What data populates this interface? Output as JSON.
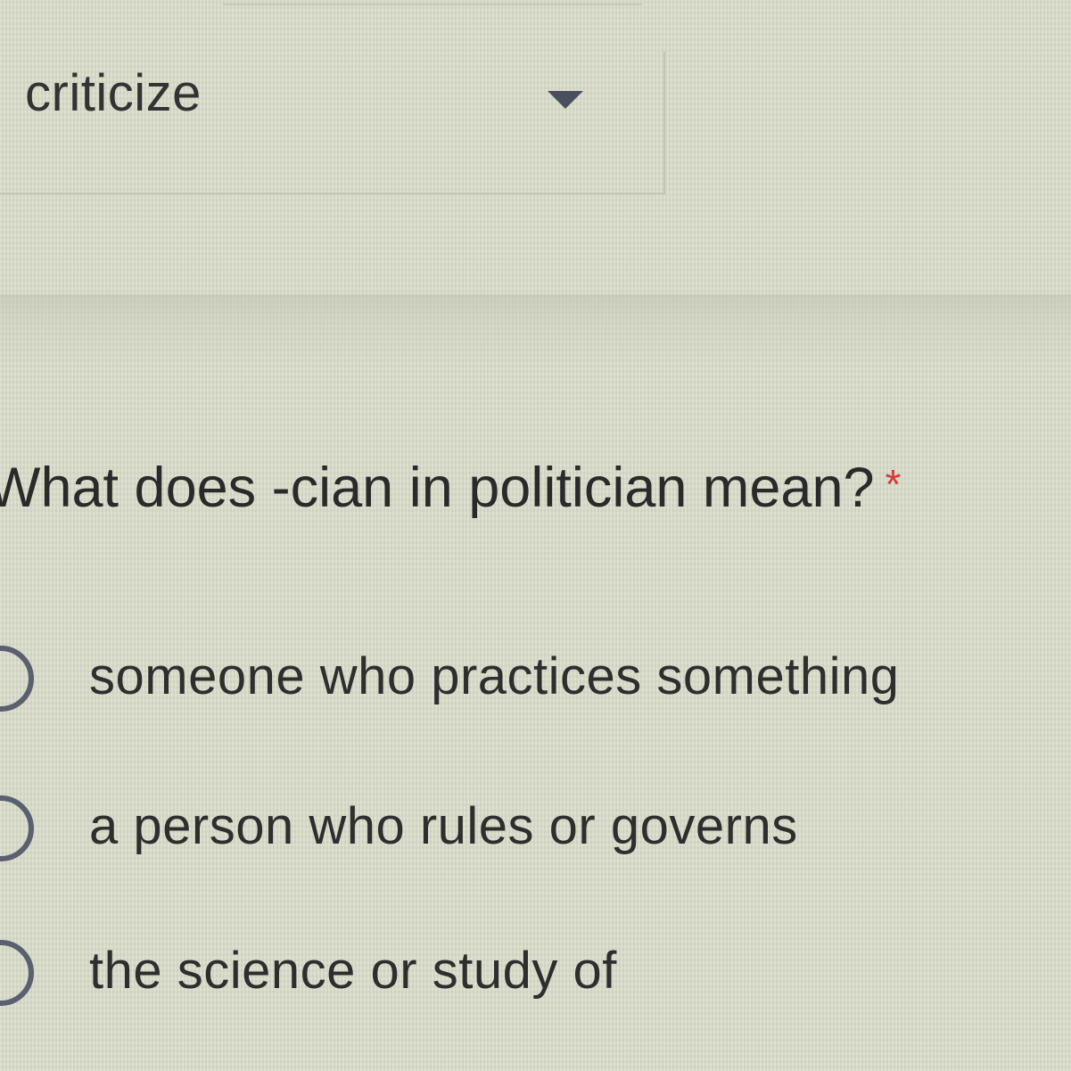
{
  "previous_question": {
    "dropdown": {
      "selected_value": "criticize"
    }
  },
  "question": {
    "text": "What does -cian in politician mean?",
    "required_marker": "*",
    "options": [
      {
        "label": "someone who practices something"
      },
      {
        "label": "a person who rules or governs"
      },
      {
        "label": "the science or study of"
      }
    ]
  },
  "colors": {
    "required_star": "#d23c3c",
    "radio_border": "#5b6070"
  },
  "icons": {
    "dropdown_arrow": "chevron-down-icon"
  }
}
